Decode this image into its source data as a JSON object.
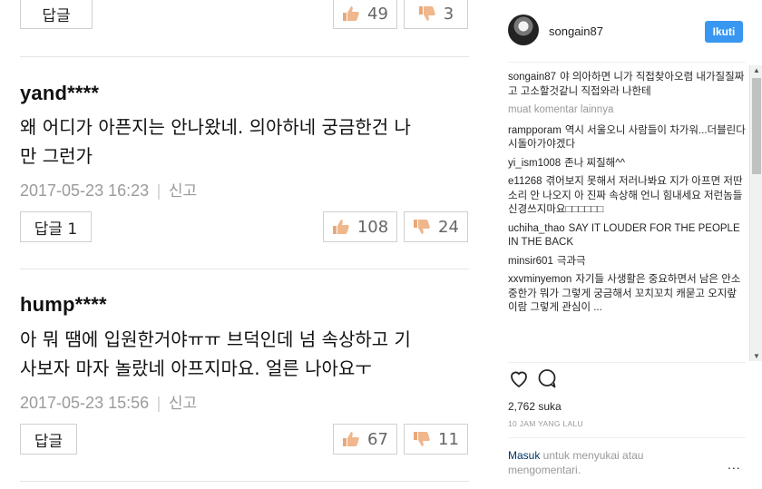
{
  "comments_panel": {
    "top_row": {
      "reply_label": "답글",
      "likes": "49",
      "dislikes": "3"
    },
    "comments": [
      {
        "username": "yand****",
        "text_line1": "왜 어디가 아픈지는 안나왔네. 의아하네 궁금한건 나",
        "text_line2": "만 그런가",
        "date": "2017-05-23 16:23",
        "report_label": "신고",
        "reply_label": "답글 1",
        "likes": "108",
        "dislikes": "24"
      },
      {
        "username": "hump****",
        "text_line1": "아 뭐 땜에 입원한거야ㅠㅠ 브덕인데 넘 속상하고 기",
        "text_line2": "사보자 마자 놀랐네 아프지마요. 얼른 나아요ㅜ",
        "date": "2017-05-23 15:56",
        "report_label": "신고",
        "reply_label": "답글",
        "likes": "67",
        "dislikes": "11"
      }
    ]
  },
  "instagram": {
    "handle": "songain87",
    "follow_label": "Ikuti",
    "caption_user": "songain87",
    "caption_text": "야 의아하면 니가 직접찾아오렴 내가질질짜고 고소할것같니 직접와라 나한테",
    "load_more": "muat komentar lainnya",
    "comments": [
      {
        "user": "rampporam",
        "text": "역시 서울오니 사람들이 차가워...더블린다시돌아가야겠다"
      },
      {
        "user": "yi_ism1008",
        "text": "존나 찌질해^^"
      },
      {
        "user": "e11268",
        "text": "겪어보지 못해서 저러나봐요 지가 아프면 저딴 소리 안 나오지 아 진짜 속상해 언니 힘내세요 저런놈들 신경쓰지마요□□□□□□"
      },
      {
        "user": "uchiha_thao",
        "text": "SAY IT LOUDER FOR THE PEOPLE IN THE BACK"
      },
      {
        "user": "minsir601",
        "text": "극과극"
      },
      {
        "user": "xxvminyemon",
        "text": "자기들 사생활은 중요하면서 남은 안소중한가 뭐가 그렇게 궁금해서 꼬치꼬치 캐묻고 오지랖이람 그렇게 관심이 ..."
      }
    ],
    "likes_count": "2,762 suka",
    "time_ago": "10 JAM YANG LALU",
    "login_link": "Masuk",
    "login_text": " untuk menyukai atau mengomentari.",
    "more_label": "..."
  },
  "colors": {
    "accent": "#3897f0",
    "thumb_up": "#e8a87c",
    "thumb_down": "#e8a87c"
  },
  "icons": [
    "thumbs-up-icon",
    "thumbs-down-icon",
    "heart-icon",
    "comment-icon",
    "more-icon"
  ]
}
